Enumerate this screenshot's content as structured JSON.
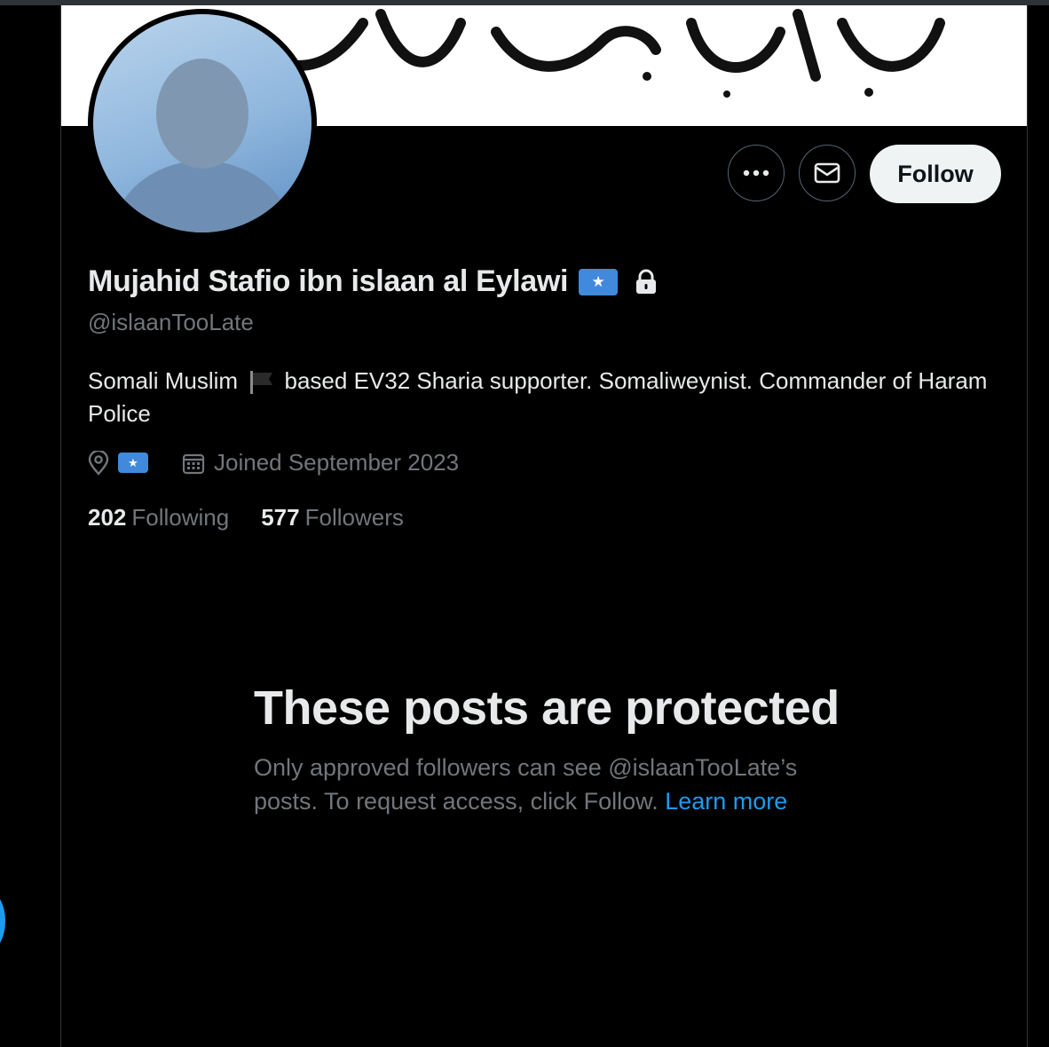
{
  "profile": {
    "display_name": "Mujahid Stafio ibn islaan al Eylawi",
    "handle": "@islaanTooLate",
    "name_flag_emoji": "flag-somalia",
    "bio_before": "Somali Muslim",
    "bio_after": " based EV32 Sharia supporter. Somaliweynist. Commander of Haram Police",
    "location_flag": "flag-somalia",
    "joined": "Joined September 2023",
    "following_count": "202",
    "following_label": "Following",
    "followers_count": "577",
    "followers_label": "Followers"
  },
  "actions": {
    "more_icon": "ellipsis-icon",
    "message_icon": "envelope-icon",
    "follow_label": "Follow"
  },
  "protected_notice": {
    "title": "These posts are protected",
    "body": "Only approved followers can see @islaanTooLate’s posts. To request access, click Follow.",
    "link": "Learn more"
  },
  "colors": {
    "background": "#000000",
    "text_primary": "#e7e9ea",
    "text_secondary": "#71767b",
    "accent": "#1d9bf0",
    "follow_button_bg": "#eff3f4",
    "somalia_flag_blue": "#4189dd"
  }
}
